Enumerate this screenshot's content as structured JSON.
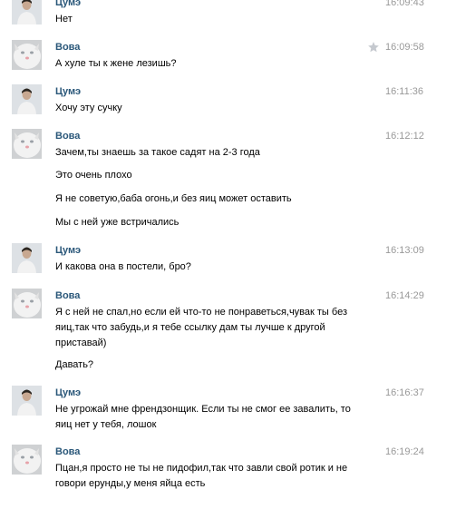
{
  "messages": [
    {
      "author": "Цумэ",
      "avatar": "boy-avatar",
      "time": "16:09:43",
      "lines": [
        "Нет"
      ]
    },
    {
      "author": "Вова",
      "avatar": "cat-avatar",
      "time": "16:09:58",
      "lines": [
        "А хуле ты к жене лезишь?"
      ],
      "starred": true
    },
    {
      "author": "Цумэ",
      "avatar": "boy-avatar",
      "time": "16:11:36",
      "lines": [
        "Хочу эту сучку"
      ]
    },
    {
      "author": "Вова",
      "avatar": "cat-avatar",
      "time": "16:12:12",
      "lines": [
        "Зачем,ты знаешь за такое садят на 2-3 года",
        "Это очень плохо",
        "Я не советую,баба огонь,и без яиц может оставить",
        "Мы с ней уже встричались"
      ]
    },
    {
      "author": "Цумэ",
      "avatar": "boy-avatar",
      "time": "16:13:09",
      "lines": [
        "И какова она в постели, бро?"
      ]
    },
    {
      "author": "Вова",
      "avatar": "cat-avatar",
      "time": "16:14:29",
      "lines": [
        "Я с ней не спал,но если ей что-то не понраветься,чувак ты без яиц,так что забудь,и я тебе ссылку дам ты лучше к другой приставай)",
        "Давать?"
      ]
    },
    {
      "author": "Цумэ",
      "avatar": "boy-avatar",
      "time": "16:16:37",
      "lines": [
        "Не угрожай мне френдзонщик. Если ты не смог ее завалить, то яиц нет у тебя, лошок"
      ]
    },
    {
      "author": "Вова",
      "avatar": "cat-avatar",
      "time": "16:19:24",
      "lines": [
        "Пцан,я просто не ты не пидофил,так что завли свой ротик и не говори ерунды,у меня яйца есть"
      ]
    }
  ],
  "colors": {
    "author": "#2b587a",
    "time": "#999999",
    "star": "#c5c9cf"
  },
  "icons": {
    "star": "star-icon"
  }
}
